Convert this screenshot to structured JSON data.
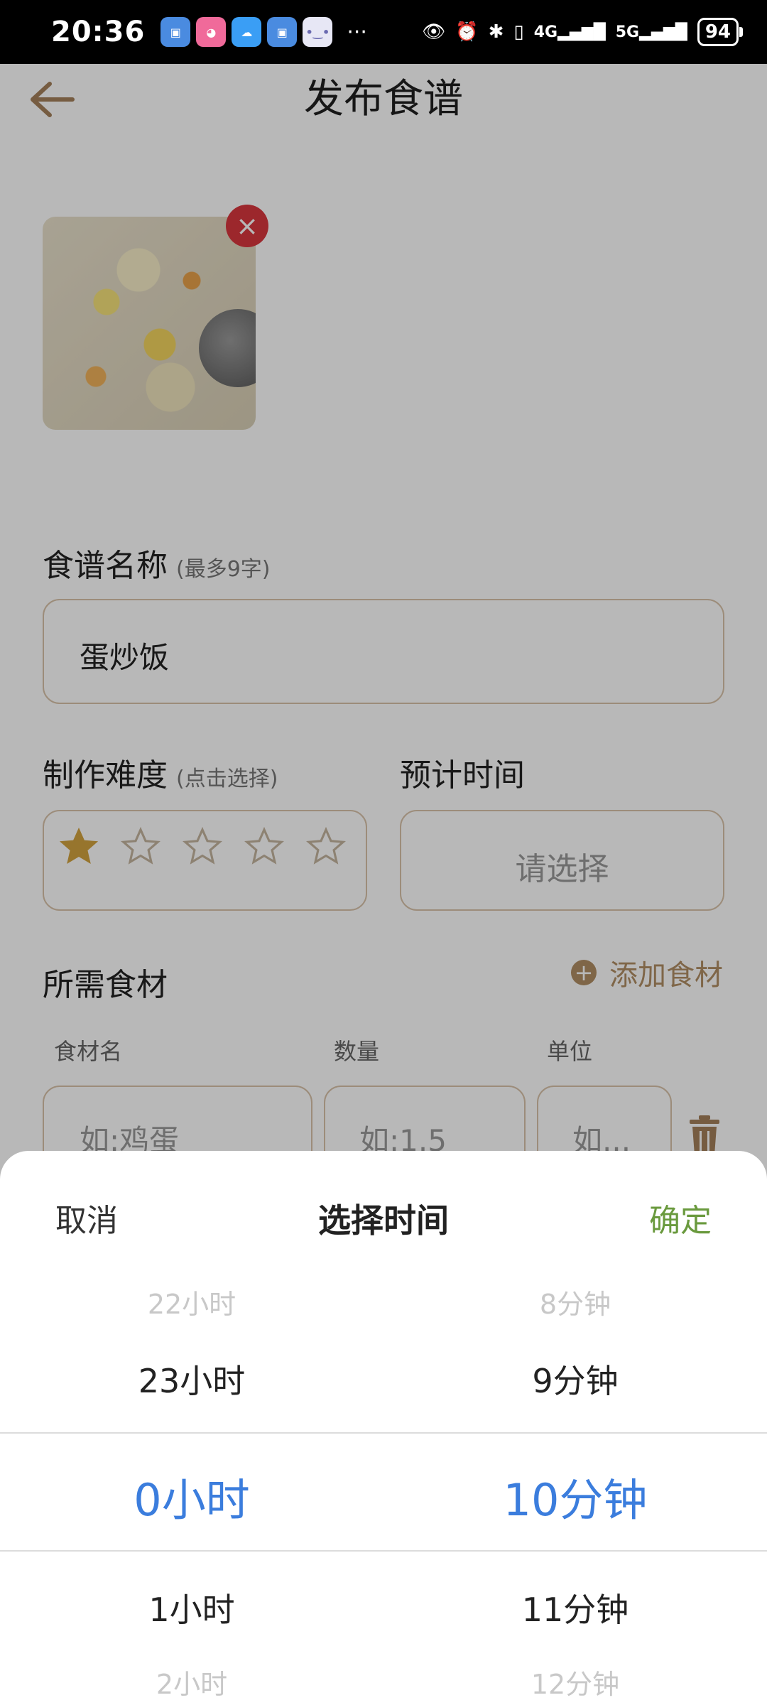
{
  "status_bar": {
    "time": "20:36",
    "more": "···",
    "signal_4g": "4G",
    "signal_5g": "5G",
    "battery": "94"
  },
  "header": {
    "title": "发布食谱"
  },
  "recipe_name": {
    "label": "食谱名称",
    "hint": "(最多9字)",
    "value": "蛋炒饭"
  },
  "difficulty": {
    "label": "制作难度",
    "hint": "(点击选择)",
    "stars_total": 5,
    "stars_selected": 1
  },
  "estimated_time": {
    "label": "预计时间",
    "value": "请选择"
  },
  "ingredients": {
    "label": "所需食材",
    "add_label": "添加食材",
    "col_name": "食材名",
    "col_qty": "数量",
    "col_unit": "单位",
    "name_placeholder": "如:鸡蛋",
    "qty_placeholder": "如:1.5",
    "unit_placeholder": "如..."
  },
  "time_picker": {
    "cancel": "取消",
    "title": "选择时间",
    "confirm": "确定",
    "hours": [
      "22小时",
      "23小时",
      "0小时",
      "1小时",
      "2小时"
    ],
    "minutes": [
      "8分钟",
      "9分钟",
      "10分钟",
      "11分钟",
      "12分钟"
    ],
    "selected_hour": "0小时",
    "selected_minute": "10分钟"
  },
  "colors": {
    "accent_brown": "#b08e64",
    "star_filled": "#d1a23f",
    "picker_selected": "#3b7ddd",
    "confirm_green": "#6a9a3e",
    "remove_red": "#d9363e"
  }
}
